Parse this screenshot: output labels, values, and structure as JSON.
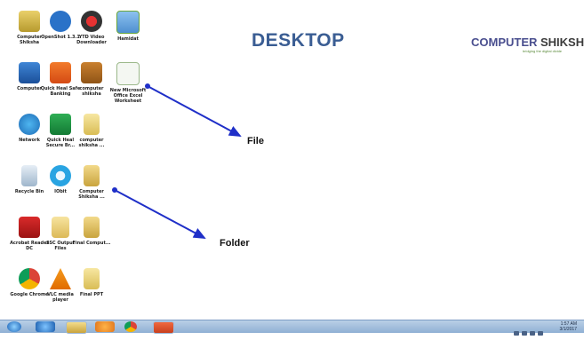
{
  "heading": "DESKTOP",
  "brand": {
    "name_a": "COMPUTER",
    "name_b": " SHIKSHA",
    "tagline": "bridging the digital divide"
  },
  "annotations": {
    "file": "File",
    "folder": "Folder"
  },
  "desktop_icons": {
    "computer_shiksha": "Computer Shiksha",
    "openshot": "OpenShot 1.3.1",
    "ytd": "YTD Video Downloader",
    "hamidat": "Hamidat",
    "computer": "Computer",
    "quickheal_safe": "Quick Heal Safe Banking",
    "computer_shiksha2": "computer shiksha",
    "excel": "New Microsoft Office Excel Worksheet",
    "network": "Network",
    "quickheal_secure": "Quick Heal Secure Br...",
    "computer_shiksha3": "computer shiksha ...",
    "recycle": "Recycle Bin",
    "iobit": "IObit",
    "computer_shiksha4": "Computer Shiksha ...",
    "acrobat": "Acrobat Reader DC",
    "ssc_output": "SSC Output Files",
    "final_computer": "Final Comput...",
    "chrome": "Google Chrome",
    "vlc": "VLC media player",
    "final_ppt": "Final PPT"
  },
  "tray": {
    "time": "1:57 AM",
    "date": "3/1/2017"
  },
  "colors": {
    "heading": "#3a5d93",
    "arrow": "#1f2fc8",
    "taskbar": "#a9c3df"
  }
}
